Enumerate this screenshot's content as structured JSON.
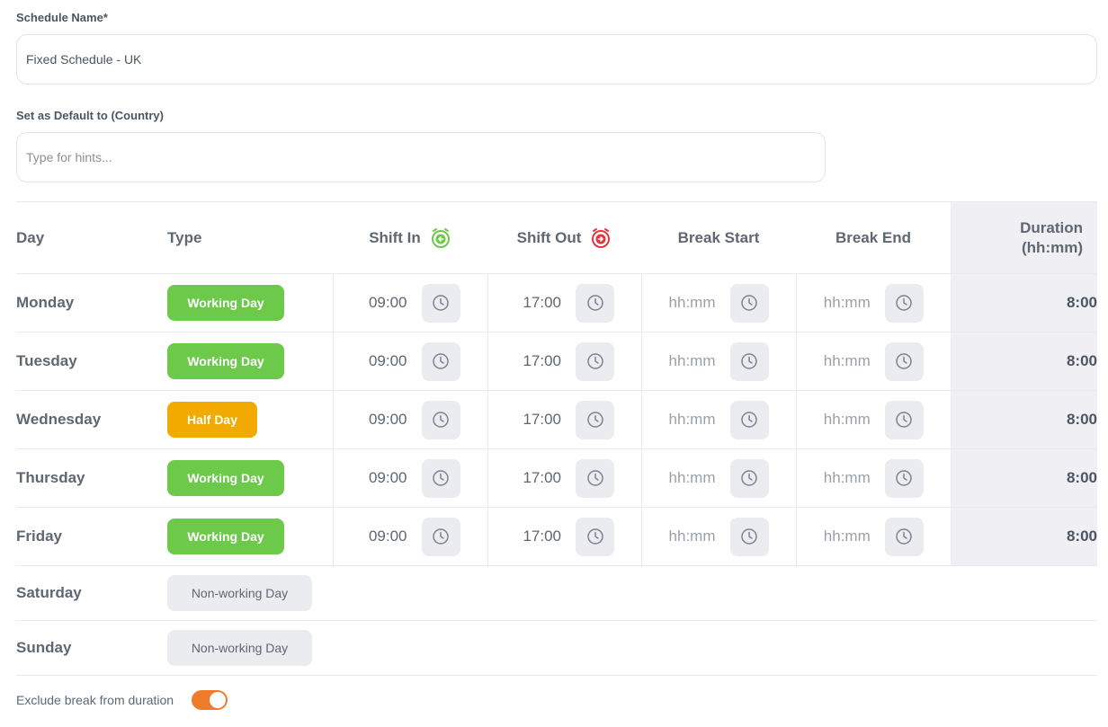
{
  "schedule_name": {
    "label": "Schedule Name*",
    "value": "Fixed Schedule - UK",
    "placeholder": ""
  },
  "default_country": {
    "label": "Set as Default to (Country)",
    "value": "",
    "placeholder": "Type for hints..."
  },
  "table": {
    "headers": {
      "day": "Day",
      "type": "Type",
      "shift_in": "Shift In",
      "shift_out": "Shift Out",
      "break_start": "Break Start",
      "break_end": "Break End",
      "duration_line1": "Duration",
      "duration_line2": "(hh:mm)"
    },
    "rows": [
      {
        "day": "Monday",
        "type": "Working Day",
        "type_color": "#6cc94a",
        "shift_in": "09:00",
        "shift_out": "17:00",
        "break_start": "hh:mm",
        "break_end": "hh:mm",
        "duration": "8:00"
      },
      {
        "day": "Tuesday",
        "type": "Working Day",
        "type_color": "#6cc94a",
        "shift_in": "09:00",
        "shift_out": "17:00",
        "break_start": "hh:mm",
        "break_end": "hh:mm",
        "duration": "8:00"
      },
      {
        "day": "Wednesday",
        "type": "Half Day",
        "type_color": "#f2a900",
        "shift_in": "09:00",
        "shift_out": "17:00",
        "break_start": "hh:mm",
        "break_end": "hh:mm",
        "duration": "8:00"
      },
      {
        "day": "Thursday",
        "type": "Working Day",
        "type_color": "#6cc94a",
        "shift_in": "09:00",
        "shift_out": "17:00",
        "break_start": "hh:mm",
        "break_end": "hh:mm",
        "duration": "8:00"
      },
      {
        "day": "Friday",
        "type": "Working Day",
        "type_color": "#6cc94a",
        "shift_in": "09:00",
        "shift_out": "17:00",
        "break_start": "hh:mm",
        "break_end": "hh:mm",
        "duration": "8:00"
      },
      {
        "day": "Saturday",
        "type": "Non-working Day",
        "type_color": "#ebecef"
      },
      {
        "day": "Sunday",
        "type": "Non-working Day",
        "type_color": "#ebecef"
      }
    ]
  },
  "exclude_break": {
    "label": "Exclude break from duration",
    "enabled": true,
    "color": "#f07b2a"
  },
  "icons": {
    "shift_in": "clock-in-icon",
    "shift_out": "clock-out-icon",
    "time_picker": "clock-icon"
  },
  "colors": {
    "shift_in_icon": "#6cc94a",
    "shift_out_icon": "#e0383e",
    "duration_column_bg": "#efeff4"
  }
}
